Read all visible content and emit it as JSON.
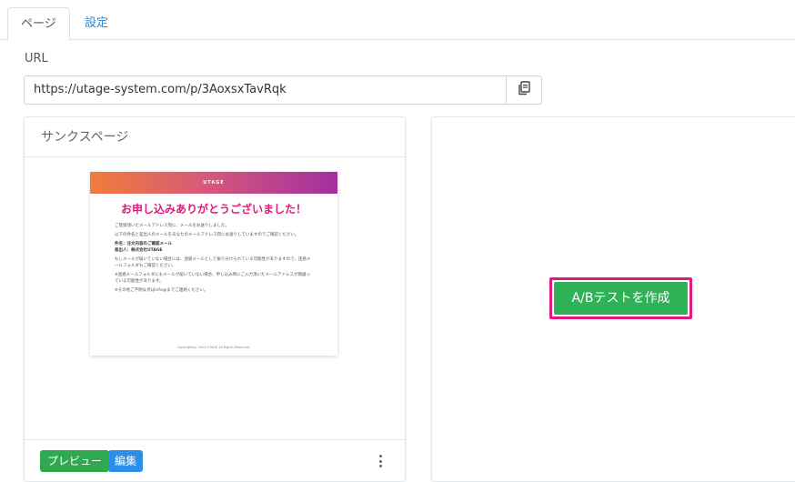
{
  "tabs": [
    {
      "label": "ページ",
      "active": true
    },
    {
      "label": "設定",
      "active": false
    }
  ],
  "url_section": {
    "label": "URL",
    "value": "https://utage-system.com/p/3AoxsxTavRqk"
  },
  "page_card": {
    "title": "サンクスページ",
    "preview_button": "プレビュー",
    "edit_button": "編集",
    "thumbnail": {
      "logo": "UTAGE",
      "heading": "お申し込みありがとうございました！",
      "paragraphs": [
        "ご登録頂いたメールアドレス宛に、メールをお送りしました。",
        "以下の件名と差出人のメールをあなたのメールアドレス宛にお送りしていますのでご確認ください。",
        "件名：注文内容のご確認メール",
        "差出人：株式会社UTAGE",
        "もしメールが届いていない場合には、迷惑メールとして振り分けられている可能性がありますので、迷惑メールフォルダもご確認ください。",
        "※迷惑メールフォルダにもメールが届いていない場合、申し込み時にご入力頂いたメールアドレスが間違っている可能性があります。",
        "※その他ご不明な点はinfo@までご連絡ください。"
      ],
      "footer": "Copyright(c) 2024 UTAGE All Rights Reserved."
    }
  },
  "ab_test": {
    "button_label": "A/Bテストを作成"
  },
  "colors": {
    "primary_green": "#2fb157",
    "edit_blue": "#2d8ee8",
    "highlight_pink": "#e0197d",
    "tab_link_blue": "#2a8ad6"
  }
}
